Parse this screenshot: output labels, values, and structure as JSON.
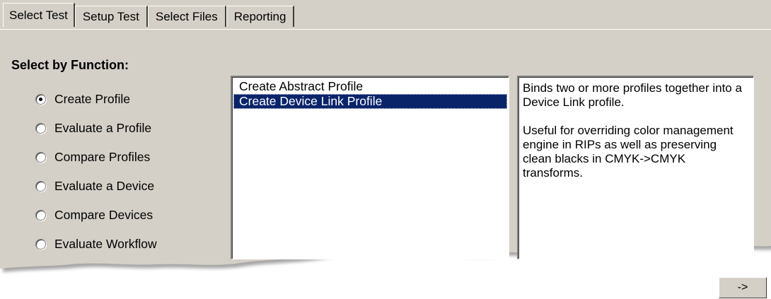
{
  "tabs": [
    {
      "label": "Select Test",
      "active": true
    },
    {
      "label": "Setup Test",
      "active": false
    },
    {
      "label": "Select Files",
      "active": false
    },
    {
      "label": "Reporting",
      "active": false
    }
  ],
  "section_title": "Select by Function:",
  "functions": [
    {
      "label": "Create Profile",
      "checked": true
    },
    {
      "label": "Evaluate a Profile",
      "checked": false
    },
    {
      "label": "Compare Profiles",
      "checked": false
    },
    {
      "label": "Evaluate a Device",
      "checked": false
    },
    {
      "label": "Compare Devices",
      "checked": false
    },
    {
      "label": "Evaluate Workflow",
      "checked": false
    }
  ],
  "test_list": [
    {
      "label": "Create Abstract Profile",
      "selected": false
    },
    {
      "label": "Create Device Link Profile",
      "selected": true
    }
  ],
  "description": {
    "paragraph1": "Binds two or more profiles together into a Device Link profile.",
    "paragraph2": "Useful for overriding color management engine in RIPs as well as preserving clean blacks in CMYK->CMYK transforms."
  },
  "next_button_label": "->",
  "colors": {
    "panel": "#d4d0c8",
    "selection": "#0a246a"
  }
}
